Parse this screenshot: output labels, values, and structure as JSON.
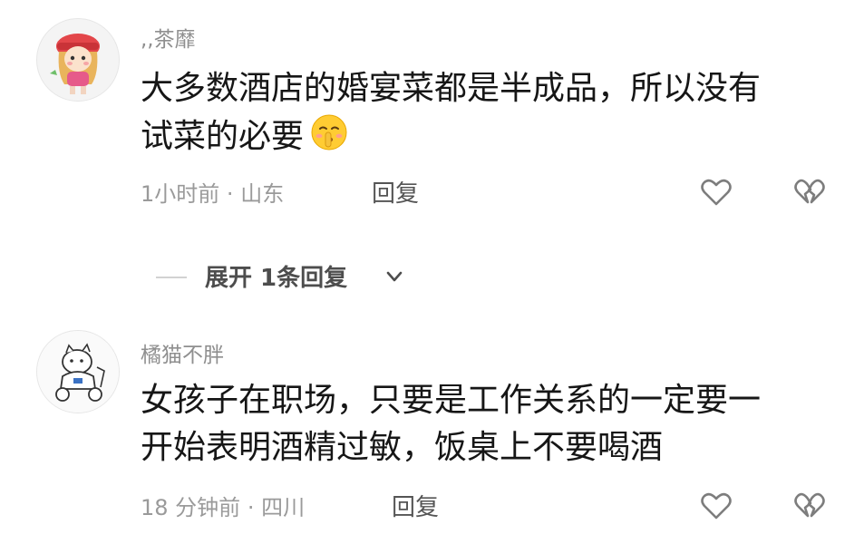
{
  "comments": [
    {
      "username": ",,茶靡",
      "line1": "大多数酒店的婚宴菜都是半成品，所以没有",
      "line2": "试菜的必要",
      "emoji": "shushing-face",
      "time": "1小时前",
      "location": "山东",
      "reply": "回复"
    },
    {
      "username": "橘猫不胖",
      "line1": "女孩子在职场，只要是工作关系的一定要一",
      "line2": "开始表明酒精过敏，饭桌上不要喝酒",
      "time": "18 分钟前",
      "location": "四川",
      "reply": "回复"
    }
  ],
  "expand": {
    "label": "展开 1条回复"
  },
  "separator": "·",
  "icons": {
    "like": "heart-outline-icon",
    "dislike": "broken-heart-icon",
    "expand": "chevron-down-icon"
  },
  "colors": {
    "text": "#161616",
    "muted": "#9a9a9a",
    "username": "#8f8f8f"
  }
}
